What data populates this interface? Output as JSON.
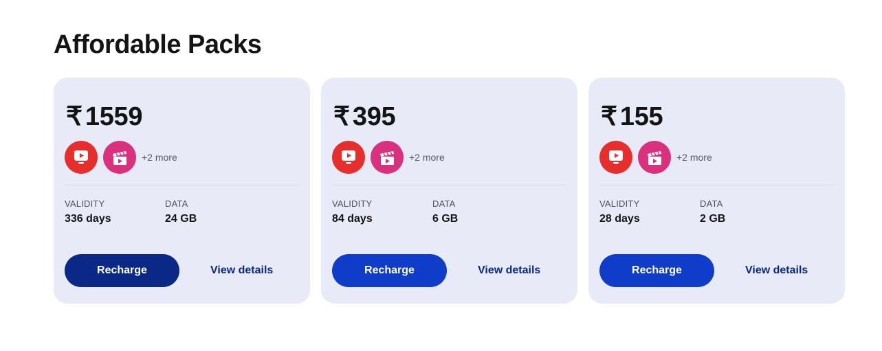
{
  "section": {
    "title": "Affordable Packs"
  },
  "currency_symbol": "₹",
  "labels": {
    "validity": "VALIDITY",
    "data": "DATA",
    "recharge": "Recharge",
    "view_details": "View details"
  },
  "colors": {
    "card_bg": "#e8eaf8",
    "recharge_active": "#0a2885",
    "recharge_default": "#0f3cc9",
    "link": "#0a2885",
    "tv_icon": "#e62e2d",
    "cinema_icon": "#d9317d"
  },
  "packs": [
    {
      "price": "1559",
      "ott_icons": [
        "tv-play-icon",
        "cinema-clapper-icon"
      ],
      "more": "+2 more",
      "validity": "336 days",
      "data": "24 GB"
    },
    {
      "price": "395",
      "ott_icons": [
        "tv-play-icon",
        "cinema-clapper-icon"
      ],
      "more": "+2 more",
      "validity": "84 days",
      "data": "6 GB"
    },
    {
      "price": "155",
      "ott_icons": [
        "tv-play-icon",
        "cinema-clapper-icon"
      ],
      "more": "+2 more",
      "validity": "28 days",
      "data": "2 GB"
    }
  ]
}
